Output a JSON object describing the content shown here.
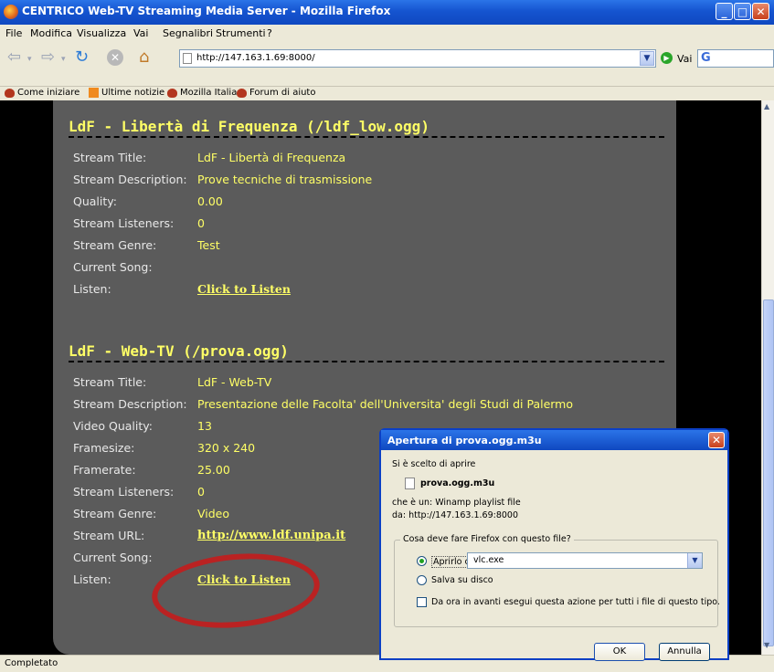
{
  "window": {
    "title": "CENTRICO Web-TV Streaming Media Server - Mozilla Firefox"
  },
  "menu": [
    "File",
    "Modifica",
    "Visualizza",
    "Vai",
    "Segnalibri",
    "Strumenti",
    "?"
  ],
  "nav": {
    "url": "http://147.163.1.69:8000/",
    "go_label": "Vai"
  },
  "bookmarks": [
    "Come iniziare",
    "Ultime notizie",
    "Mozilla Italia",
    "Forum di aiuto"
  ],
  "streams": [
    {
      "heading": "LdF - Libertà di Frequenza (/ldf_low.ogg)",
      "rows": [
        {
          "label": "Stream Title:",
          "value": "LdF - Libertà di Frequenza"
        },
        {
          "label": "Stream Description:",
          "value": "Prove tecniche di trasmissione"
        },
        {
          "label": "Quality:",
          "value": "0.00"
        },
        {
          "label": "Stream Listeners:",
          "value": "0"
        },
        {
          "label": "Stream Genre:",
          "value": "Test"
        },
        {
          "label": "Current Song:",
          "value": ""
        },
        {
          "label": "Listen:",
          "value": "Click to Listen"
        }
      ]
    },
    {
      "heading": "LdF - Web-TV (/prova.ogg)",
      "rows": [
        {
          "label": "Stream Title:",
          "value": "LdF - Web-TV"
        },
        {
          "label": "Stream Description:",
          "value": "Presentazione delle Facolta' dell'Universita' degli Studi di Palermo"
        },
        {
          "label": "Video Quality:",
          "value": "13"
        },
        {
          "label": "Framesize:",
          "value": "320 x 240"
        },
        {
          "label": "Framerate:",
          "value": "25.00"
        },
        {
          "label": "Stream Listeners:",
          "value": "0"
        },
        {
          "label": "Stream Genre:",
          "value": "Video"
        },
        {
          "label": "Stream URL:",
          "value": "http://www.ldf.unipa.it"
        },
        {
          "label": "Current Song:",
          "value": ""
        },
        {
          "label": "Listen:",
          "value": "Click to Listen"
        }
      ]
    }
  ],
  "status": "Completato",
  "dialog": {
    "title": "Apertura di prova.ogg.m3u",
    "intro": "Si è scelto di aprire",
    "filename": "prova.ogg.m3u",
    "type_line": "che è un:  Winamp playlist file",
    "from_line": "da: http://147.163.1.69:8000",
    "group_label": "Cosa deve fare Firefox con questo file?",
    "open_with_label": "Aprirlo con",
    "app": "vlc.exe",
    "save_label": "Salva su disco",
    "remember_label": "Da ora in avanti esegui questa azione per tutti i file di questo tipo.",
    "ok": "OK",
    "cancel": "Annulla"
  }
}
